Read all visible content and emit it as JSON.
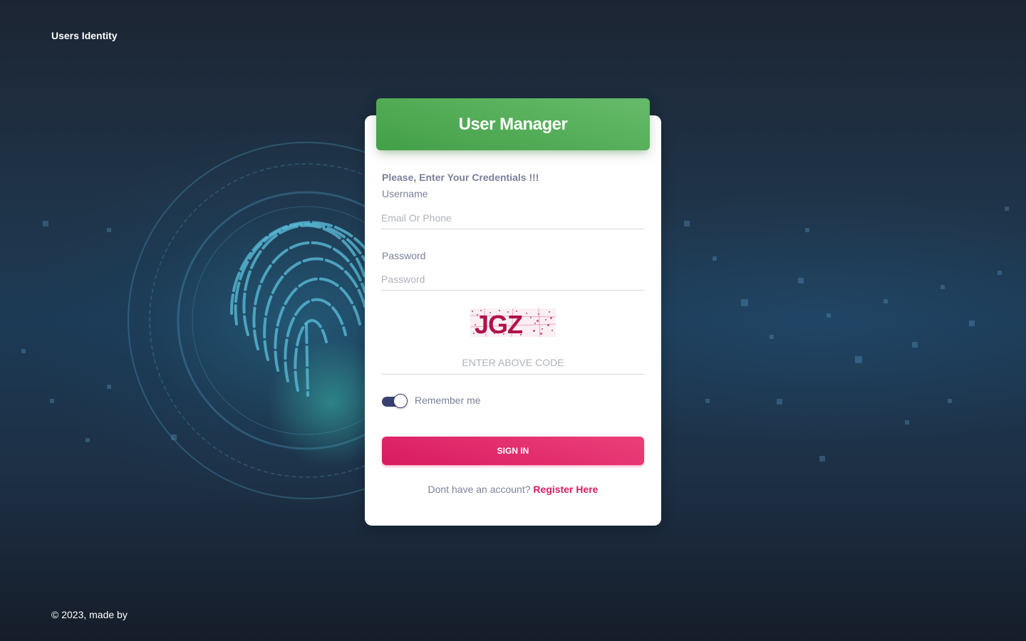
{
  "header": {
    "brand": "Users Identity"
  },
  "card": {
    "title": "User Manager",
    "subtitle": "Please, Enter Your Credentials !!!",
    "username_label": "Username",
    "username_placeholder": "Email Or Phone",
    "password_label": "Password",
    "password_placeholder": "Password",
    "captcha_text": "JGZ",
    "code_placeholder": "ENTER ABOVE CODE",
    "remember_label": "Remember me",
    "remember_checked": true,
    "signin_label": "SIGN IN",
    "register_prompt": "Dont have an account?",
    "register_link": "Register Here"
  },
  "footer": {
    "text": "© 2023, made by"
  },
  "colors": {
    "header_green": "#4caf50",
    "primary_pink": "#e91e63",
    "text_muted": "#7b809a",
    "toggle_dark": "#3a416f"
  },
  "icons": {
    "background": "fingerprint-icon"
  }
}
